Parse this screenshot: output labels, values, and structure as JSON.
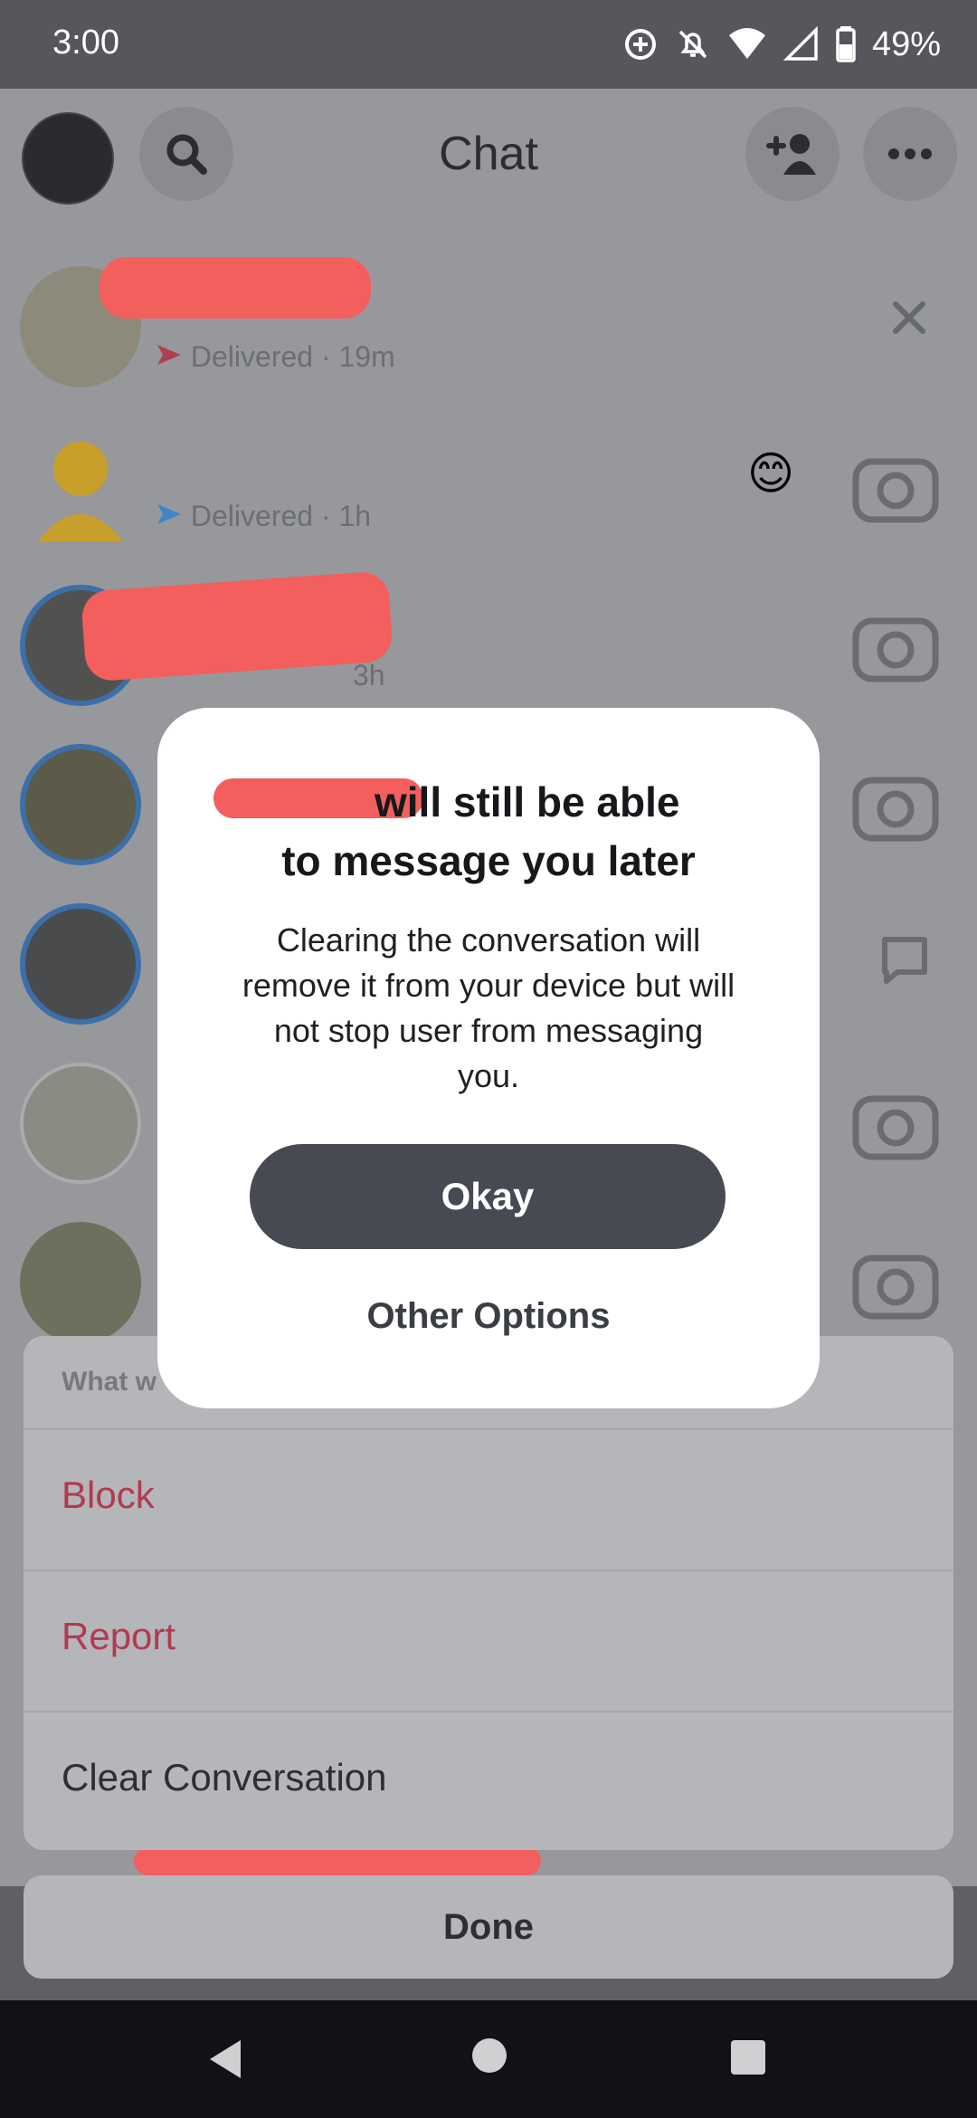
{
  "status_bar": {
    "time": "3:00",
    "battery": "49%",
    "icons": [
      "data-saver-icon",
      "notifications-off-icon",
      "wifi-icon",
      "signal-icon",
      "battery-icon"
    ]
  },
  "header": {
    "title": "Chat"
  },
  "chats": [
    {
      "status": "Delivered",
      "time": "19m",
      "status_color": "#b0404f",
      "action_icon": "close-icon"
    },
    {
      "status": "Delivered",
      "time": "1h",
      "status_color": "#3e86c8",
      "emoji": "😊",
      "action_icon": "camera-icon"
    },
    {
      "time": "3h",
      "action_icon": "camera-icon"
    },
    {
      "action_icon": "camera-icon"
    },
    {
      "action_icon": "chat-bubble-icon"
    },
    {
      "action_icon": "camera-icon"
    },
    {
      "action_icon": "camera-icon"
    }
  ],
  "sheet": {
    "heading": "What w",
    "items": [
      {
        "label": "Block",
        "color": "#b23a4f"
      },
      {
        "label": "Report",
        "color": "#b23a4f"
      },
      {
        "label": "Clear Conversation",
        "color": "#2d2f33"
      }
    ],
    "done_label": "Done"
  },
  "modal": {
    "title_line1": "will still be able",
    "title_line2": "to message you later",
    "body": "Clearing the conversation will remove it from your device but will not stop user from messaging you.",
    "okay_label": "Okay",
    "other_label": "Other Options"
  },
  "colors": {
    "redaction": "#f25f5c",
    "accent_blue": "#3c6fa8",
    "primary_button": "#474a52"
  }
}
